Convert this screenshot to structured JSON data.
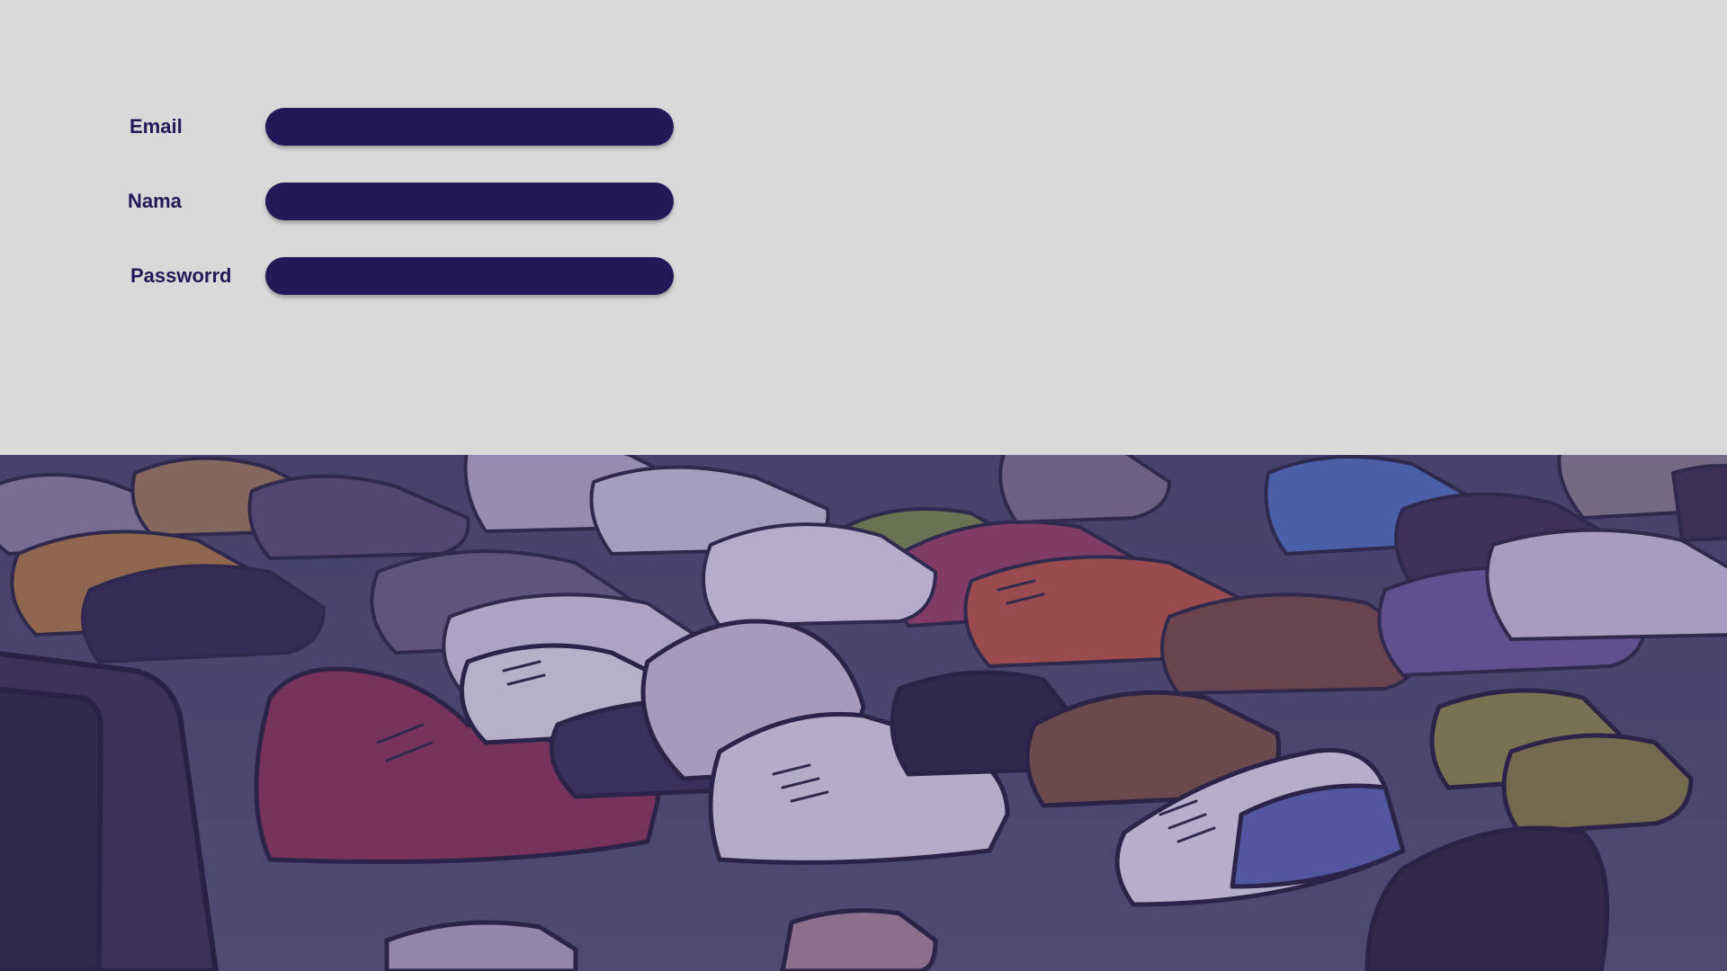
{
  "form": {
    "fields": [
      {
        "label": "Email",
        "value": "",
        "placeholder": ""
      },
      {
        "label": "Nama",
        "value": "",
        "placeholder": ""
      },
      {
        "label": "Passworrd",
        "value": "",
        "placeholder": ""
      }
    ]
  },
  "hero": {
    "image_subject": "shoe-pile-illustration"
  },
  "colors": {
    "background": "#d9d9d9",
    "accent": "#221a58",
    "hero_overlay": "#3e3568"
  }
}
